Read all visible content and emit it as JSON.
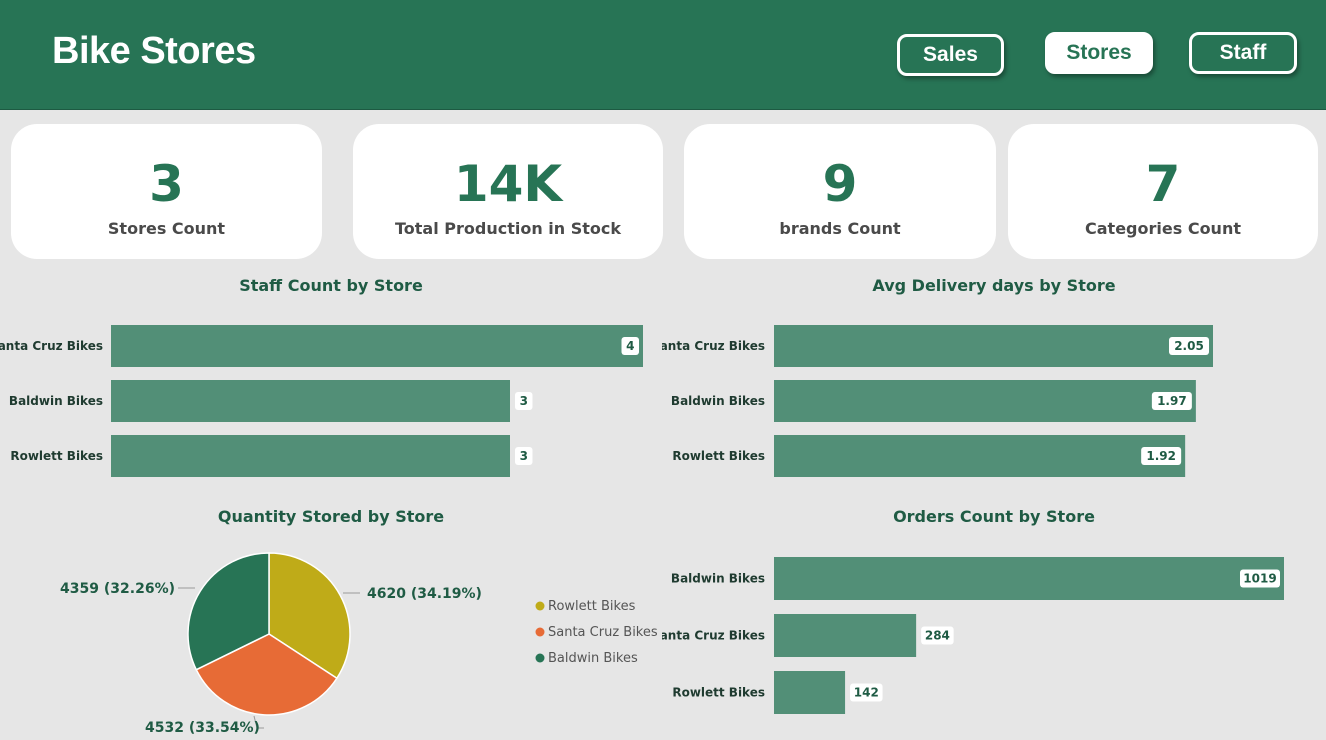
{
  "header": {
    "title": "Bike Stores",
    "nav": {
      "sales": "Sales",
      "stores": "Stores",
      "staff": "Staff"
    }
  },
  "kpis": [
    {
      "value": "3",
      "label": "Stores Count"
    },
    {
      "value": "14K",
      "label": "Total Production in Stock"
    },
    {
      "value": "9",
      "label": "brands Count"
    },
    {
      "value": "7",
      "label": "Categories Count"
    }
  ],
  "colors": {
    "accent": "#277455",
    "bar": "#528f77",
    "pie_rowlett": "#bfab18",
    "pie_santa_cruz": "#e76b36",
    "pie_baldwin": "#277455"
  },
  "chart_data": [
    {
      "id": "staff",
      "type": "bar",
      "orientation": "horizontal",
      "title": "Staff Count by Store",
      "categories": [
        "Santa Cruz Bikes",
        "Baldwin Bikes",
        "Rowlett Bikes"
      ],
      "values": [
        4,
        3,
        3
      ],
      "labels": [
        "4",
        "3",
        "3"
      ],
      "xlim": [
        0,
        4
      ]
    },
    {
      "id": "delivery",
      "type": "bar",
      "orientation": "horizontal",
      "title": "Avg Delivery days by Store",
      "categories": [
        "Santa Cruz Bikes",
        "Baldwin Bikes",
        "Rowlett Bikes"
      ],
      "values": [
        2.05,
        1.97,
        1.92
      ],
      "labels": [
        "2.05",
        "1.97",
        "1.92"
      ],
      "xlim": [
        0,
        2.05
      ]
    },
    {
      "id": "quantity",
      "type": "pie",
      "title": "Quantity Stored by Store",
      "categories": [
        "Rowlett Bikes",
        "Santa Cruz Bikes",
        "Baldwin Bikes"
      ],
      "values": [
        4620,
        4532,
        4359
      ],
      "labels": [
        "4620 (34.19%)",
        "4532 (33.54%)",
        "4359 (32.26%)"
      ],
      "legend": "right"
    },
    {
      "id": "orders",
      "type": "bar",
      "orientation": "horizontal",
      "title": "Orders Count by Store",
      "categories": [
        "Baldwin Bikes",
        "Santa Cruz Bikes",
        "Rowlett Bikes"
      ],
      "values": [
        1019,
        284,
        142
      ],
      "labels": [
        "1019",
        "284",
        "142"
      ],
      "xlim": [
        0,
        1019
      ]
    }
  ]
}
